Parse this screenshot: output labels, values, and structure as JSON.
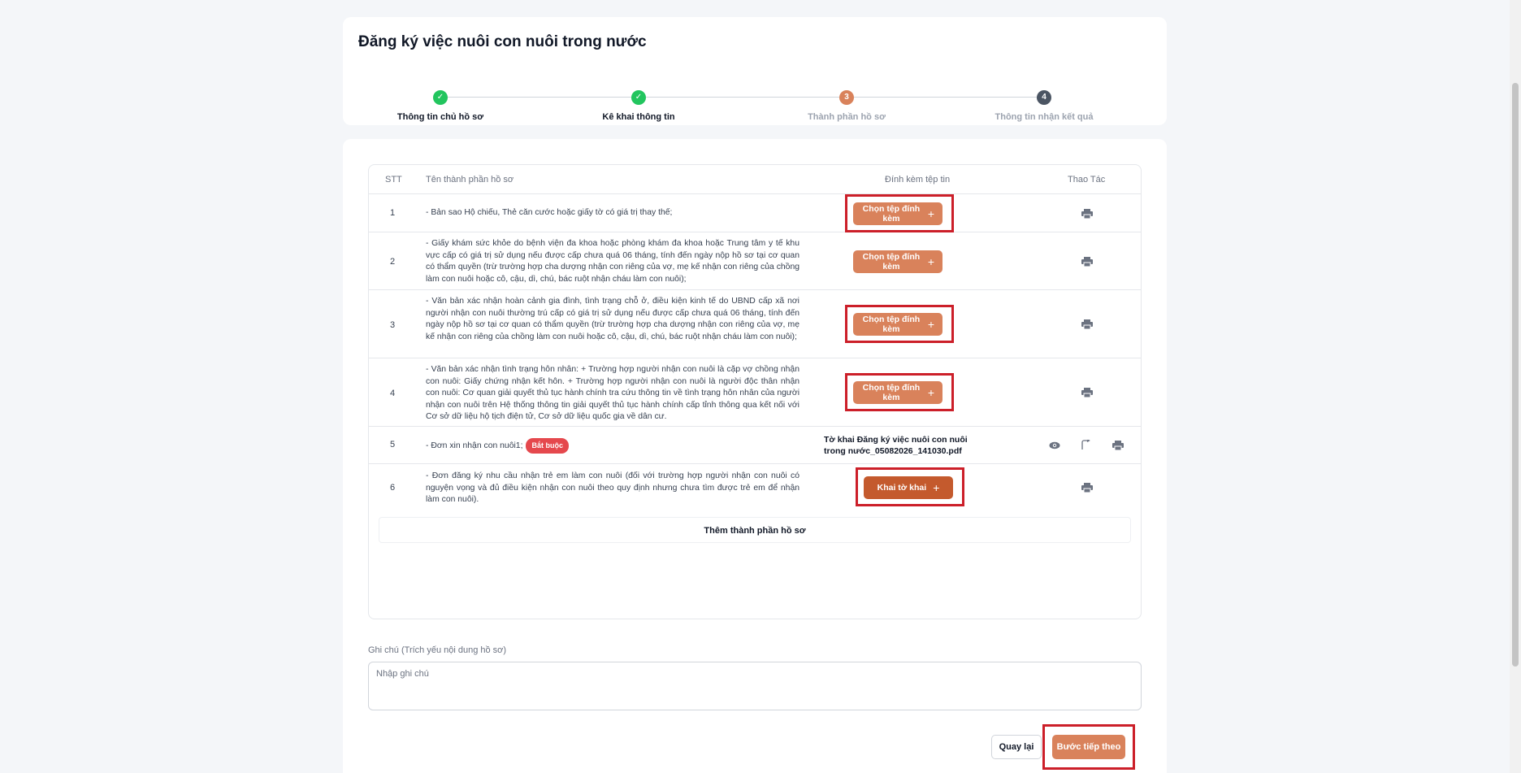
{
  "page": {
    "title": "Đăng ký việc nuôi con nuôi trong nước"
  },
  "stepper": {
    "steps": [
      {
        "label": "Thông tin chủ hồ sơ",
        "status": "done",
        "marker": "✓"
      },
      {
        "label": "Kê khai thông tin",
        "status": "done",
        "marker": "✓"
      },
      {
        "label": "Thành phần hồ sơ",
        "status": "active",
        "marker": "3"
      },
      {
        "label": "Thông tin nhận kết quả",
        "status": "todo",
        "marker": "4"
      }
    ]
  },
  "table": {
    "headers": {
      "stt": "STT",
      "name": "Tên thành phần hồ sơ",
      "attach": "Đính kèm tệp tin",
      "actions": "Thao Tác"
    },
    "rows": [
      {
        "stt": "1",
        "name": "- Bản sao Hộ chiếu, Thẻ căn cước hoặc giấy tờ có giá trị thay thế;",
        "button": "Chọn tệp đính kèm"
      },
      {
        "stt": "2",
        "name": "- Giấy khám sức khỏe do bệnh viện đa khoa hoặc phòng khám đa khoa hoặc Trung tâm y tế khu vực cấp có giá trị sử dụng nếu được cấp chưa quá 06 tháng, tính đến ngày nộp hồ sơ tại cơ quan có thẩm quyền (trừ trường hợp cha dượng nhận con riêng của vợ, mẹ kế nhận con riêng của chồng làm con nuôi hoặc cô, cậu, dì, chú, bác ruột nhận cháu làm con nuôi);",
        "button": "Chọn tệp đính kèm"
      },
      {
        "stt": "3",
        "name": "- Văn bản xác nhận hoàn cảnh gia đình, tình trạng chỗ ở, điều kiện kinh tế do UBND cấp xã nơi người nhận con nuôi thường trú cấp có giá trị sử dụng nếu được cấp chưa quá 06 tháng, tính đến ngày nộp hồ sơ tại cơ quan có thẩm quyền (trừ trường hợp cha dượng nhận con riêng của vợ, mẹ kế nhận con riêng của chồng làm con nuôi hoặc cô, cậu, dì, chú, bác ruột nhận cháu làm con nuôi);",
        "button": "Chọn tệp đính kèm"
      },
      {
        "stt": "4",
        "name": "- Văn bản xác nhận tình trạng hôn nhân: + Trường hợp người nhận con nuôi là cặp vợ chồng nhận con nuôi: Giấy chứng nhận kết hôn. + Trường hợp người nhận con nuôi là người độc thân nhận con nuôi: Cơ quan giải quyết thủ tục hành chính tra cứu thông tin về tình trạng hôn nhân của người nhận con nuôi trên Hệ thống thông tin giải quyết thủ tục hành chính cấp tỉnh thông qua kết nối với Cơ sở dữ liệu hộ tịch điện tử, Cơ sở dữ liệu quốc gia về dân cư.",
        "button": "Chọn tệp đính kèm"
      },
      {
        "stt": "5",
        "name": "- Đơn xin nhận con nuôi1;",
        "badge": "Bắt buộc",
        "file": "Tờ khai Đăng ký việc nuôi con nuôi trong nước_05082026_141030.pdf"
      },
      {
        "stt": "6",
        "name": "- Đơn đăng ký nhu cầu nhận trẻ em làm con nuôi (đối với trường hợp người nhận con nuôi có nguyện vọng và đủ điều kiện nhận con nuôi theo quy định nhưng chưa tìm được trẻ em để nhận làm con nuôi).",
        "button": "Khai tờ khai"
      }
    ],
    "add_row": "Thêm thành phần hồ sơ"
  },
  "note": {
    "label": "Ghi chú (Trích yếu nội dung hồ sơ)",
    "placeholder": "Nhập ghi chú",
    "value": ""
  },
  "actions": {
    "back": "Quay lại",
    "next": "Bước tiếp theo"
  },
  "colors": {
    "accent": "#d9825b",
    "accent_dark": "#c45a2d",
    "success": "#22c55e",
    "highlight": "#cc1f29",
    "required_badge": "#e5484d"
  },
  "icons": {
    "step_done": "check-icon",
    "print": "printer-icon",
    "view": "eye-icon",
    "replace": "replace-file-icon",
    "add": "plus-icon"
  }
}
